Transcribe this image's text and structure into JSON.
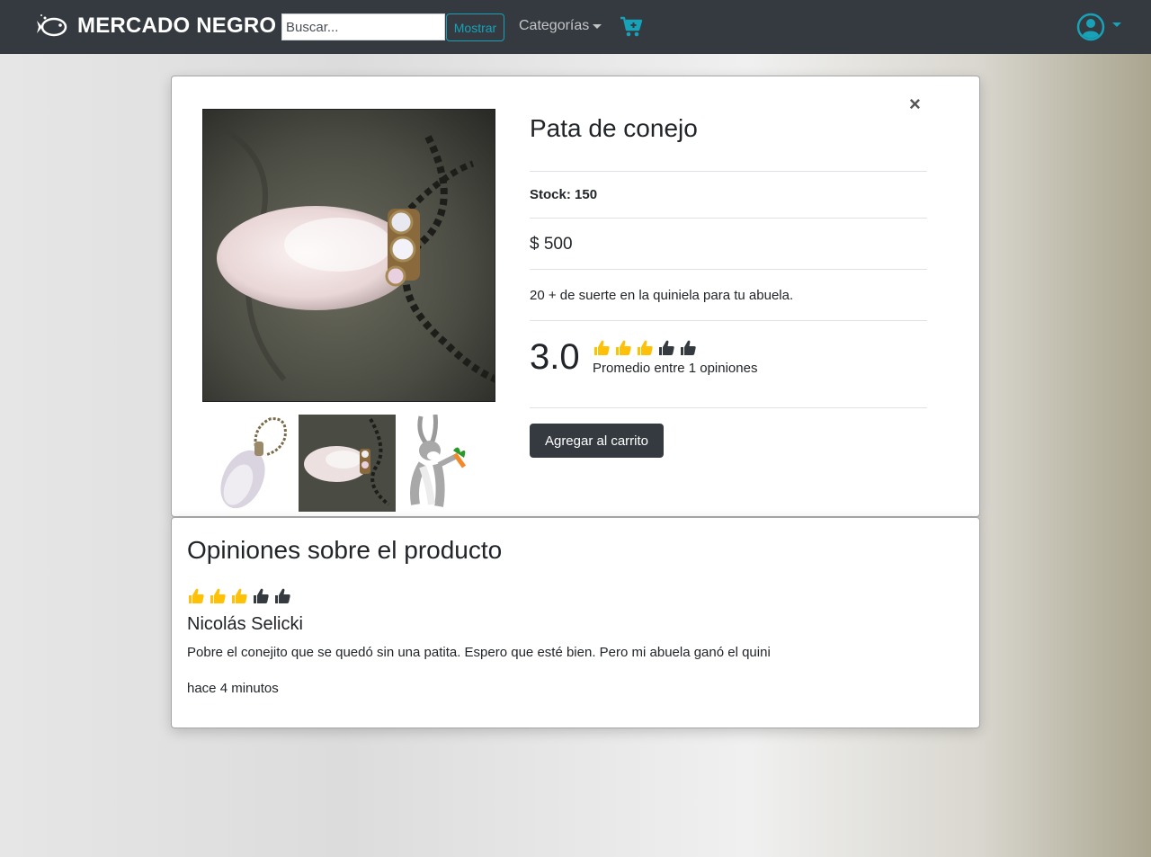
{
  "navbar": {
    "brand_name": "MERCADO NEGRO",
    "search_placeholder": "Buscar...",
    "show_button": "Mostrar",
    "categories_label": "Categorías",
    "accent_color": "#17a2b8"
  },
  "product": {
    "title": "Pata de conejo",
    "stock_label": "Stock: 150",
    "price_label": "$ 500",
    "description": "20 + de suerte en la quiniela para tu abuela.",
    "rating_value": "3.0",
    "rating_stars_filled": 3,
    "rating_stars_total": 5,
    "rating_summary": "Promedio entre 1 opiniones",
    "add_to_cart_label": "Agregar al carrito",
    "close_symbol": "×",
    "thumbnails": [
      "rabbit-foot-keychain",
      "rabbit-foot-pendant",
      "bugs-bunny"
    ],
    "selected_thumbnail": 2
  },
  "opinions": {
    "title": "Opiniones sobre el producto",
    "items": [
      {
        "stars_filled": 3,
        "stars_total": 5,
        "author": "Nicolás Selicki",
        "text": "Pobre el conejito que se quedó sin una patita. Espero que esté bien. Pero mi abuela ganó el quini",
        "time": "hace 4 minutos"
      }
    ]
  },
  "colors": {
    "navbar_bg": "#343a40",
    "thumb_filled": "#ffc107",
    "thumb_empty": "#343a40",
    "button_dark": "#343a40"
  }
}
